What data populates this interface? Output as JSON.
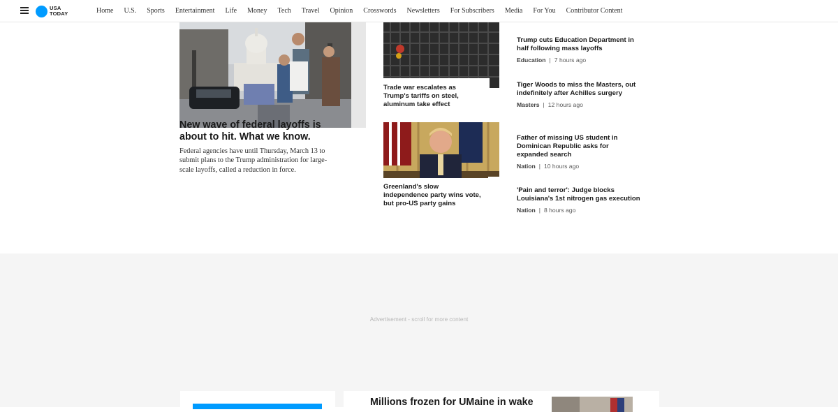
{
  "header": {
    "brand_line1": "USA",
    "brand_line2": "TODAY",
    "nav": [
      "Home",
      "U.S.",
      "Sports",
      "Entertainment",
      "Life",
      "Money",
      "Tech",
      "Travel",
      "Opinion",
      "Crosswords",
      "Newsletters",
      "For Subscribers",
      "Media",
      "For You",
      "Contributor Content"
    ]
  },
  "lead": {
    "headline": "New wave of federal layoffs is about to hit. What we know.",
    "summary": "Federal agencies have until Thursday, March 13 to submit plans to the Trump administration for large-scale layoffs, called a reduction in force."
  },
  "center": [
    {
      "headline": "Trade war escalates as Trump's tariffs on steel, aluminum take effect"
    },
    {
      "headline": "Greenland's slow independence party wins vote, but pro-US party gains"
    }
  ],
  "list": [
    {
      "headline": "Trump cuts Education Department in half following mass layoffs",
      "topic": "Education",
      "time": "7 hours ago"
    },
    {
      "headline": "Tiger Woods to miss the Masters, out indefinitely after Achilles surgery",
      "topic": "Masters",
      "time": "12 hours ago"
    },
    {
      "headline": "Father of missing US student in Dominican Republic asks for expanded search",
      "topic": "Nation",
      "time": "10 hours ago"
    },
    {
      "headline": "'Pain and terror': Judge blocks Louisiana's 1st nitrogen gas execution",
      "topic": "Nation",
      "time": "8 hours ago"
    }
  ],
  "ad": {
    "label": "Advertisement - scroll for more content"
  },
  "bottom": {
    "headline": "Millions frozen for UMaine in wake"
  },
  "colors": {
    "brand": "#009bff",
    "ad_background": "#f5f5f5"
  }
}
